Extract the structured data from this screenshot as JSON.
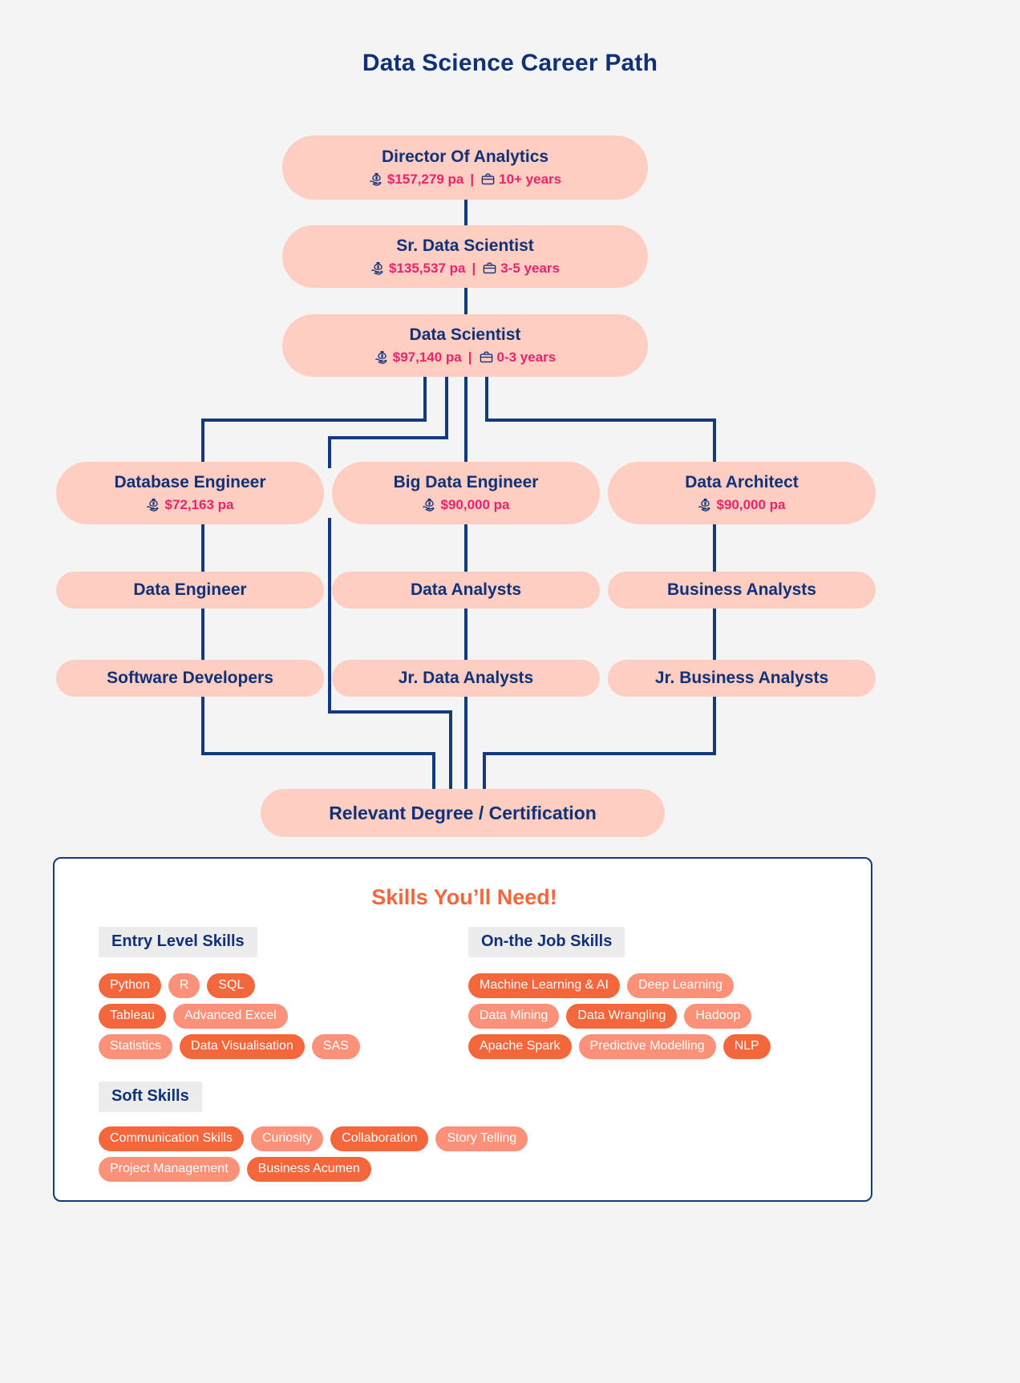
{
  "title": "Data Science Career Path",
  "icons": {
    "salary": "money-bag-hand-icon",
    "experience": "briefcase-icon"
  },
  "colors": {
    "page_background": "#f4f4f4",
    "navy": "#0f3178",
    "node_fill": "#ffcec2",
    "salary_text": "#e8246c",
    "accent_orange": "#f4663c",
    "accent_orange_light": "#fb9179",
    "section_label_bg": "#ececec",
    "card_border": "#123a7d"
  },
  "nodes": {
    "director": {
      "title": "Director Of Analytics",
      "salary": "$157,279 pa",
      "separator": "|",
      "experience": "10+ years"
    },
    "sr_data_scientist": {
      "title": "Sr. Data Scientist",
      "salary": "$135,537 pa",
      "separator": "|",
      "experience": "3-5 years"
    },
    "data_scientist": {
      "title": "Data Scientist",
      "salary": "$97,140 pa",
      "separator": "|",
      "experience": "0-3 years"
    },
    "database_engineer": {
      "title": "Database Engineer",
      "salary": "$72,163 pa"
    },
    "big_data_engineer": {
      "title": "Big Data Engineer",
      "salary": "$90,000 pa"
    },
    "data_architect": {
      "title": "Data Architect",
      "salary": "$90,000 pa"
    },
    "data_engineer": {
      "title": "Data Engineer"
    },
    "data_analysts": {
      "title": "Data Analysts"
    },
    "business_analysts": {
      "title": "Business Analysts"
    },
    "software_developers": {
      "title": "Software Developers"
    },
    "jr_data_analysts": {
      "title": "Jr. Data Analysts"
    },
    "jr_business_analysts": {
      "title": "Jr. Business Analysts"
    },
    "degree": {
      "title": "Relevant Degree / Certification"
    }
  },
  "skills": {
    "heading": "Skills You’ll Need!",
    "entry": {
      "label": "Entry Level Skills",
      "rows": [
        [
          {
            "text": "Python",
            "shade": "dark"
          },
          {
            "text": "R",
            "shade": "light"
          },
          {
            "text": "SQL",
            "shade": "dark"
          }
        ],
        [
          {
            "text": "Tableau",
            "shade": "dark"
          },
          {
            "text": "Advanced Excel",
            "shade": "light"
          }
        ],
        [
          {
            "text": "Statistics",
            "shade": "light"
          },
          {
            "text": "Data Visualisation",
            "shade": "dark"
          },
          {
            "text": "SAS",
            "shade": "light"
          }
        ]
      ]
    },
    "onjob": {
      "label": "On-the Job Skills",
      "rows": [
        [
          {
            "text": "Machine Learning & AI",
            "shade": "dark"
          },
          {
            "text": "Deep Learning",
            "shade": "light"
          }
        ],
        [
          {
            "text": "Data Mining",
            "shade": "light"
          },
          {
            "text": "Data Wrangling",
            "shade": "dark"
          },
          {
            "text": "Hadoop",
            "shade": "light"
          }
        ],
        [
          {
            "text": "Apache Spark",
            "shade": "dark"
          },
          {
            "text": "Predictive Modelling",
            "shade": "light"
          },
          {
            "text": "NLP",
            "shade": "dark"
          }
        ]
      ]
    },
    "soft": {
      "label": "Soft Skills",
      "rows": [
        [
          {
            "text": "Communication Skills",
            "shade": "dark"
          },
          {
            "text": "Curiosity",
            "shade": "light"
          },
          {
            "text": "Collaboration",
            "shade": "dark"
          },
          {
            "text": "Story Telling",
            "shade": "light"
          }
        ],
        [
          {
            "text": "Project Management",
            "shade": "light"
          },
          {
            "text": "Business Acumen",
            "shade": "dark"
          }
        ]
      ]
    }
  }
}
